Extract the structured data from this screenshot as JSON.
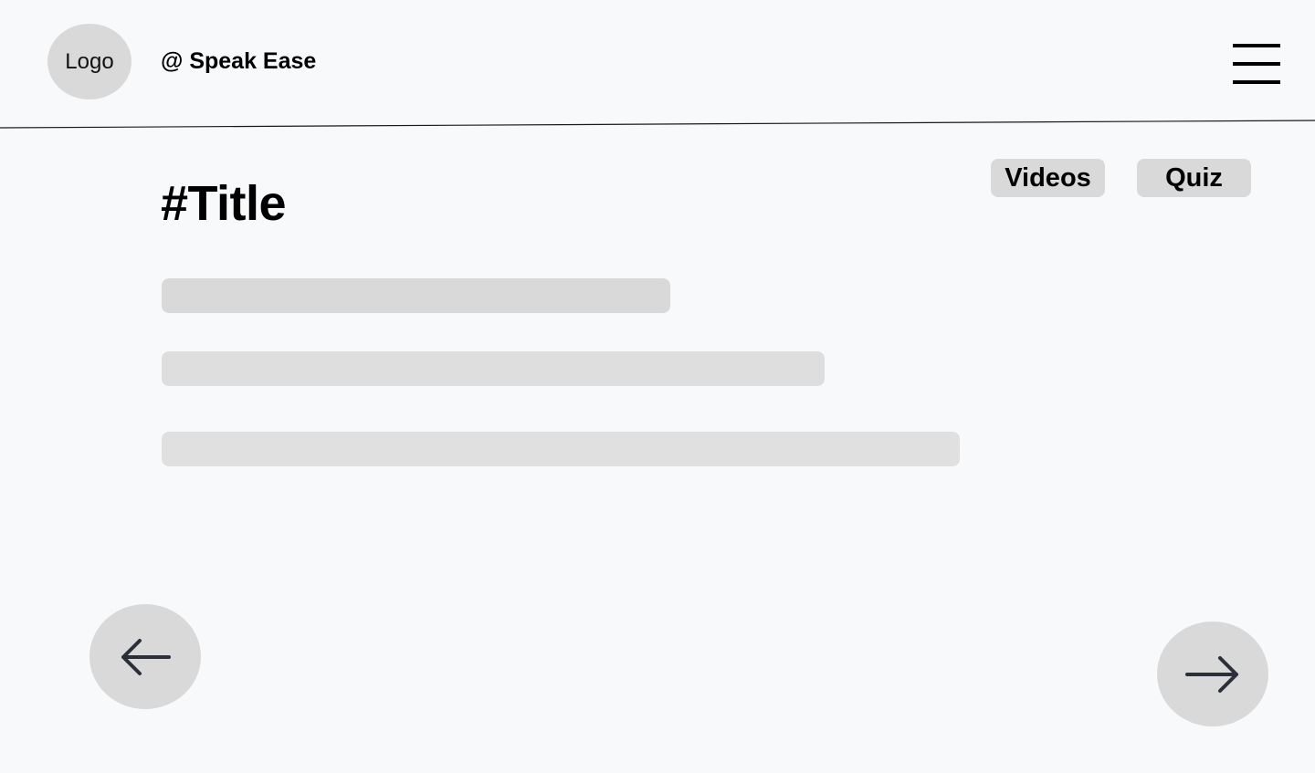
{
  "header": {
    "logo_text": "Logo",
    "brand": "@ Speak Ease",
    "menu_icon": "hamburger-menu-icon"
  },
  "main": {
    "title": "#Title",
    "tabs": [
      {
        "label": "Videos"
      },
      {
        "label": "Quiz"
      }
    ]
  },
  "navigation": {
    "prev_icon": "arrow-left-icon",
    "next_icon": "arrow-right-icon"
  },
  "colors": {
    "background": "#f8f9fb",
    "placeholder": "#d9d9d9",
    "icon": "#2b2f3a"
  }
}
